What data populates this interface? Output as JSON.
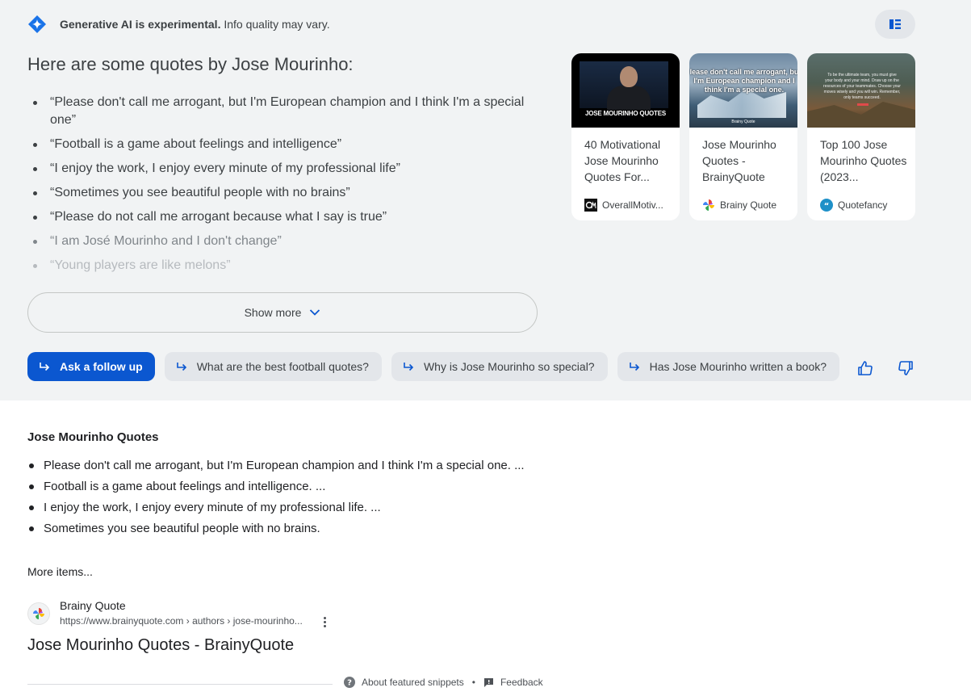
{
  "sge": {
    "notice_bold": "Generative AI is experimental.",
    "notice_rest": " Info quality may vary.",
    "title": "Here are some quotes by Jose Mourinho:",
    "quotes": [
      "“Please don't call me arrogant, but I'm European champion and I think I'm a special one”",
      "“Football is a game about feelings and intelligence”",
      "“I enjoy the work, I enjoy every minute of my professional life”",
      "“Sometimes you see beautiful people with no brains”",
      "“Please do not call me arrogant because what I say is true”",
      "“I am José Mourinho and I don't change”",
      "“Young players are like melons”"
    ],
    "show_more": "Show more",
    "cards": [
      {
        "image_caption": "JOSE MOURINHO QUOTES",
        "title": "40 Motivational Jose Mourinho Quotes For...",
        "source": "OverallMotiv..."
      },
      {
        "image_caption": "lease don't call me arrogant, bu I'm European champion and I think I'm a special one.",
        "image_watermark": "Brainy Quote",
        "title": "Jose Mourinho Quotes - BrainyQuote",
        "source": "Brainy Quote"
      },
      {
        "image_caption": "To be the ultimate team, you must give your body and your mind. Draw up on the resources of your teammates. Choose your moves wisely and you will win. Remember, only teams succeed.",
        "title": "Top 100 Jose Mourinho Quotes (2023...",
        "source": "Quotefancy"
      }
    ],
    "followups": {
      "primary": "Ask a follow up",
      "suggestions": [
        "What are the best football quotes?",
        "Why is Jose Mourinho so special?",
        "Has Jose Mourinho written a book?"
      ]
    },
    "colors": {
      "panel_bg": "#f1f3f4",
      "accent": "#0b57d0"
    }
  },
  "snippet": {
    "title": "Jose Mourinho Quotes",
    "items": [
      "Please don't call me arrogant, but I'm European champion and I think I'm a special one. ...",
      "Football is a game about feelings and intelligence. ...",
      "I enjoy the work, I enjoy every minute of my professional life. ...",
      "Sometimes you see beautiful people with no brains."
    ],
    "more_items": "More items...",
    "source_name": "Brainy Quote",
    "source_url": "https://www.brainyquote.com › authors › jose-mourinho...",
    "result_title": "Jose Mourinho Quotes - BrainyQuote"
  },
  "footer": {
    "about": "About featured snippets",
    "separator": "•",
    "feedback": "Feedback"
  }
}
